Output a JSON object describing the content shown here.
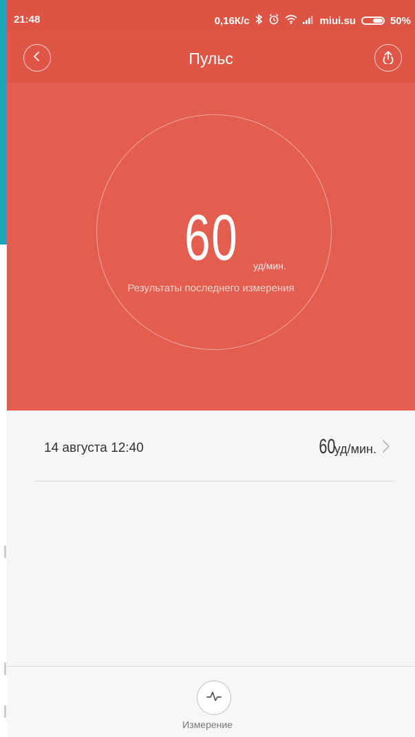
{
  "status_bar": {
    "time": "21:48",
    "speed": "0,16К/с",
    "carrier": "miui.su",
    "battery": "50%",
    "icons": [
      "bluetooth-icon",
      "alarm-icon",
      "wifi-icon",
      "signal-icon",
      "battery-icon"
    ]
  },
  "header": {
    "title": "Пульс",
    "back_icon": "chevron-left-icon",
    "share_icon": "upload-icon"
  },
  "hero": {
    "bpm": "60",
    "unit": "уд/мин.",
    "label": "Результаты последнего измерения"
  },
  "records": [
    {
      "date": "14 августа 12:40",
      "value": "60",
      "unit": "уд/мин."
    }
  ],
  "bottom": {
    "measure_label": "Измерение",
    "measure_icon": "pulse-wave-icon"
  },
  "colors": {
    "status_bar": "#dd5444",
    "header": "#e05646",
    "hero": "#e35e4f",
    "background": "#f6f6f6"
  }
}
